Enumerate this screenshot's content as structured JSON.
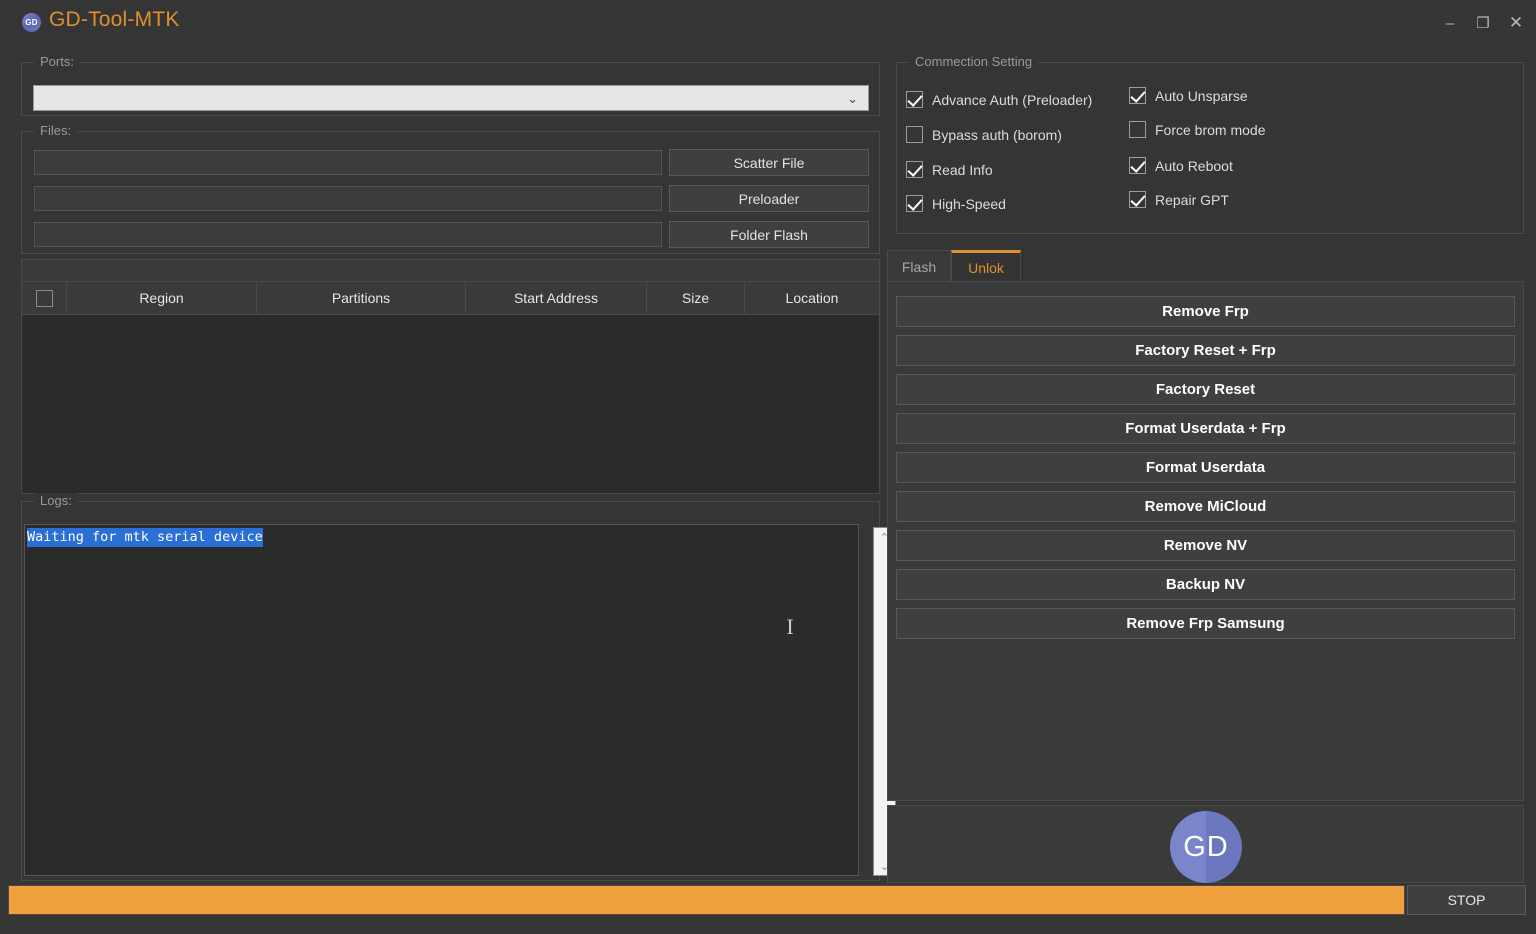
{
  "window": {
    "title": "GD-Tool-MTK",
    "badge_text": "GD",
    "minimize_icon": "–",
    "maximize_icon": "❐",
    "close_icon": "✕"
  },
  "ports": {
    "legend": "Ports:",
    "selected_value": "",
    "chevron_icon": "⌄"
  },
  "files": {
    "legend": "Files:",
    "inputs": [
      {
        "value": "",
        "placeholder": ""
      },
      {
        "value": "",
        "placeholder": ""
      },
      {
        "value": "",
        "placeholder": ""
      }
    ],
    "buttons": [
      "Scatter File",
      "Preloader",
      "Folder Flash"
    ]
  },
  "table": {
    "columns": [
      "Region",
      "Partitions",
      "Start Address",
      "Size",
      "Location"
    ],
    "select_all_checked": false,
    "rows": []
  },
  "logs": {
    "legend": "Logs:",
    "lines": [
      "Waiting for mtk serial device"
    ],
    "scroll_up_icon": "⌃",
    "scroll_down_icon": "⌄",
    "caret_icon": "I"
  },
  "connection": {
    "legend": "Commection Setting",
    "left_column": [
      {
        "label": "Advance Auth (Preloader)",
        "checked": true
      },
      {
        "label": "Bypass auth (borom)",
        "checked": false
      },
      {
        "label": "Read Info",
        "checked": true
      },
      {
        "label": "High-Speed",
        "checked": true
      }
    ],
    "right_column": [
      {
        "label": "Auto Unsparse",
        "checked": true
      },
      {
        "label": "Force brom mode",
        "checked": false
      },
      {
        "label": "Auto Reboot",
        "checked": true
      },
      {
        "label": "Repair GPT",
        "checked": true
      }
    ]
  },
  "tabs": [
    {
      "label": "Flash",
      "active": false
    },
    {
      "label": "Unlok",
      "active": true
    }
  ],
  "unlock_actions": [
    "Remove Frp",
    "Factory Reset + Frp",
    "Factory Reset",
    "Format Userdata + Frp",
    "Format Userdata",
    "Remove MiCloud",
    "Remove NV",
    "Backup NV",
    "Remove Frp Samsung"
  ],
  "logo": {
    "text": "GD"
  },
  "statusbar": {
    "progress_percent": 100,
    "progress_color": "#f0a03c",
    "stop_label": "STOP"
  },
  "colors": {
    "window_background": "#353535",
    "panel_background": "#3a3a3a",
    "table_background": "#2b2b2b",
    "accent_orange": "#e08f2e",
    "progress_orange": "#f0a03c",
    "logo_blue": "#7a86cc",
    "log_selection_blue": "#2a6fd6"
  }
}
